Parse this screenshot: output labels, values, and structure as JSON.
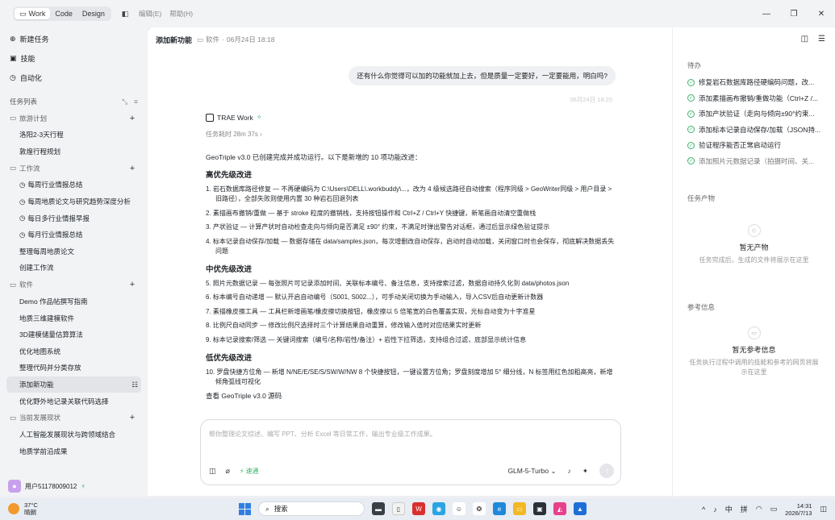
{
  "topbar": {
    "modes": [
      "Work",
      "Code",
      "Design"
    ],
    "active_mode": "Work",
    "menus": [
      "编辑(E)",
      "帮助(H)"
    ]
  },
  "sidebar": {
    "nav": [
      {
        "icon": "new-task-icon",
        "label": "新建任务"
      },
      {
        "icon": "skills-icon",
        "label": "技能"
      },
      {
        "icon": "automation-icon",
        "label": "自动化"
      }
    ],
    "task_list_title": "任务列表",
    "groups": [
      {
        "name": "旅游计划",
        "items": [
          "洛阳2-3天行程",
          "敦煌行程规划"
        ]
      },
      {
        "name": "工作流",
        "items": [
          "每周行业情报总结",
          "每周地质论文与研究趋势深度分析",
          "每日多行业情报早报",
          "每月行业情报总结",
          "整理每周地质论文",
          "创建工作流"
        ]
      },
      {
        "name": "软件",
        "items": [
          "Demo 作品帖撰写指南",
          "地质三维建模软件",
          "3D建模储量估算算法",
          "优化地图系统",
          "整理代码并分类存放",
          "添加新功能",
          "优化野外地记录关联代码选择"
        ]
      },
      {
        "name": "当前发展现状",
        "items": [
          "人工智能发展现状与跨领域结合",
          "地质学前沿成果"
        ]
      }
    ],
    "active_item": "添加新功能",
    "user": "用户51178009012"
  },
  "main": {
    "title": "添加新功能",
    "folder": "软件",
    "date": "06月24日 18:18",
    "user_message": "还有什么你觉得可以加的功能就加上去，但是质量一定要好，一定要能用，明白吗?",
    "user_meta": "06月24日 18:20",
    "agent_name": "TRAE Work",
    "elapsed": "任务耗时 28m 37s",
    "intro": "GeoTriple v3.0 已创建完成并成功运行。以下是新增的 10 项功能改进：",
    "sections": [
      {
        "title": "高优先级改进",
        "items": [
          "1. 岩石数据库路径修复 — 不再硬编码为 C:\\Users\\DELL\\.workbuddy\\...，改为 4 级候选路径自动搜索（程序同级 > GeoWriter同级 > 用户目录 > 旧路径），全部失败则使用内置 30 种岩石回退列表",
          "2. 素描画布撤销/重做 — 基于 stroke 粒度的撤销栈，支持按钮操作和 Ctrl+Z / Ctrl+Y 快捷键，新笔画自动清空重做栈",
          "3. 产状验证 — 计算产状时自动检查走向与倾向是否满足 ±90° 约束，不满足时弹出警告对话框，通过后显示绿色验证提示",
          "4. 标本记录自动保存/加载 — 数据存储在 data/samples.json，每次增删改自动保存，启动时自动加载，关闭窗口时也会保存，彻底解决数据丢失问题"
        ]
      },
      {
        "title": "中优先级改进",
        "items": [
          "5. 照片元数据记录 — 每张照片可记录添加时间、关联标本编号、备注信息，支持搜索过滤，数据自动持久化到 data/photos.json",
          "6. 标本编号自动递增 — 默认开启自动编号（S001, S002...），可手动关闭切换为手动输入，导入CSV后自动更新计数器",
          "7. 素描橡皮擦工具 — 工具栏新增画笔/橡皮擦切换按钮，橡皮擦以 5 倍笔宽的白色覆盖实现，光标自动变为十字准星",
          "8. 比例尺自动同步 — 修改比例尺选择时三个计算结果自动重算，修改输入值时对应结果实时更新",
          "9. 标本记录搜索/筛选 — 关键词搜索（编号/名称/岩性/备注）+ 岩性下拉筛选，支持组合过滤，底部显示统计信息"
        ]
      },
      {
        "title": "低优先级改进",
        "items": [
          "10. 罗盘快捷方位角 — 新增 N/NE/E/SE/S/SW/W/NW 8 个快捷按钮，一键设置方位角；罗盘刻度增加 5° 细分线，N 标签用红色加粗高亮，新增倾角弧线可视化"
        ]
      }
    ],
    "source_link": "查看 GeoTriple v3.0 源码",
    "composer_placeholder": "帮你整理论文综述、编写 PPT、分析 Excel 等日常工作，输出专业级工作成果。",
    "fast_label": "速通",
    "model": "GLM-5-Turbo"
  },
  "right": {
    "todo_title": "待办",
    "todos": [
      "修复岩石数据库路径硬编码问题，改...",
      "添加素描画布撤销/重做功能（Ctrl+Z /...",
      "添加产状验证（走向与倾向±90°约束...",
      "添加标本记录自动保存/加载（JSON持...",
      "验证程序能否正常启动运行",
      "添加照片元数据记录（拍摄时间、关..."
    ],
    "outputs_title": "任务产物",
    "outputs_empty_title": "暂无产物",
    "outputs_empty_desc": "任务完成后，生成的文件将展示在这里",
    "refs_title": "参考信息",
    "refs_empty_title": "暂无参考信息",
    "refs_empty_desc": "任务执行过程中调用的技能和参考的网页将展示在这里"
  },
  "taskbar": {
    "temp": "37°C",
    "weather": "晴朗",
    "search": "搜索",
    "ime1": "中",
    "ime2": "拼",
    "time": "14:31",
    "date": "2026/7/13"
  }
}
